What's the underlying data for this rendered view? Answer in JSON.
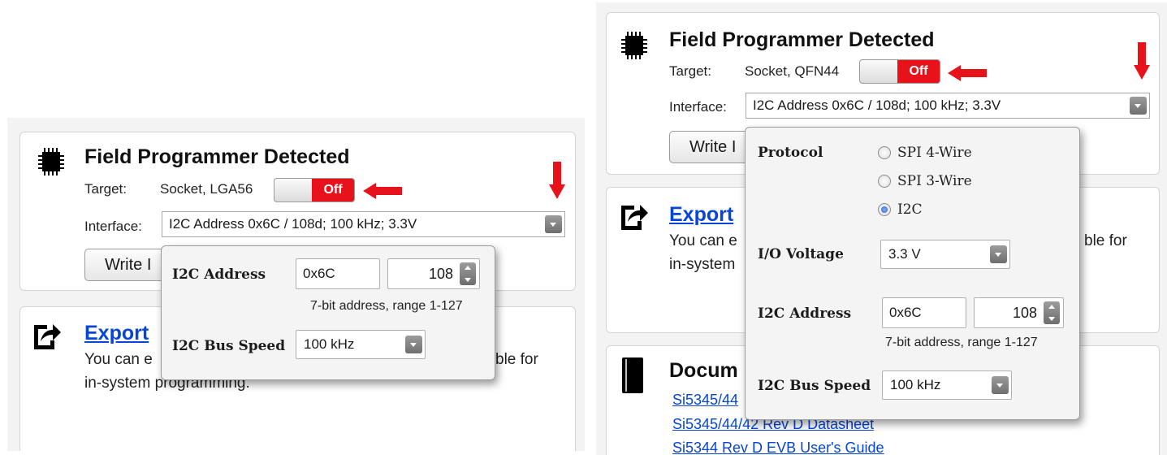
{
  "left": {
    "device": {
      "title": "Field Programmer Detected",
      "target_label": "Target:",
      "target_value": "Socket, LGA56",
      "toggle_label": "Off",
      "interface_label": "Interface:",
      "interface_value": "I2C Address 0x6C / 108d; 100 kHz; 3.3V",
      "write_button": "Write I"
    },
    "export": {
      "title": "Export",
      "desc_left": "You can e",
      "desc_right": "ble for",
      "desc_line2": "in-system programming."
    },
    "popup": {
      "i2c_address_label": "I2C Address",
      "i2c_address_hex": "0x6C",
      "i2c_address_dec": "108",
      "address_hint": "7-bit address, range 1-127",
      "bus_speed_label": "I2C Bus Speed",
      "bus_speed_value": "100 kHz"
    }
  },
  "right": {
    "device": {
      "title": "Field Programmer Detected",
      "target_label": "Target:",
      "target_value": "Socket, QFN44",
      "toggle_label": "Off",
      "interface_label": "Interface:",
      "interface_value": "I2C Address 0x6C / 108d; 100 kHz; 3.3V",
      "write_button": "Write I"
    },
    "export": {
      "title": "Export",
      "desc_left": "You can e",
      "desc_right": "ble for",
      "desc_line2": "in-system"
    },
    "docs": {
      "title": "Docum",
      "links": [
        "Si5345/44",
        "Si5345/44/42 Rev D Datasheet",
        "Si5344 Rev D EVB User's Guide"
      ]
    },
    "popup": {
      "protocol_label": "Protocol",
      "protocol_options": [
        "SPI 4-Wire",
        "SPI 3-Wire",
        "I2C"
      ],
      "protocol_selected": "I2C",
      "io_voltage_label": "I/O Voltage",
      "io_voltage_value": "3.3 V",
      "i2c_address_label": "I2C Address",
      "i2c_address_hex": "0x6C",
      "i2c_address_dec": "108",
      "address_hint": "7-bit address, range 1-127",
      "bus_speed_label": "I2C Bus Speed",
      "bus_speed_value": "100 kHz"
    }
  },
  "colors": {
    "toggle_off": "#e8131a",
    "link": "#0645d6",
    "annotation_arrow": "#e8131a"
  }
}
